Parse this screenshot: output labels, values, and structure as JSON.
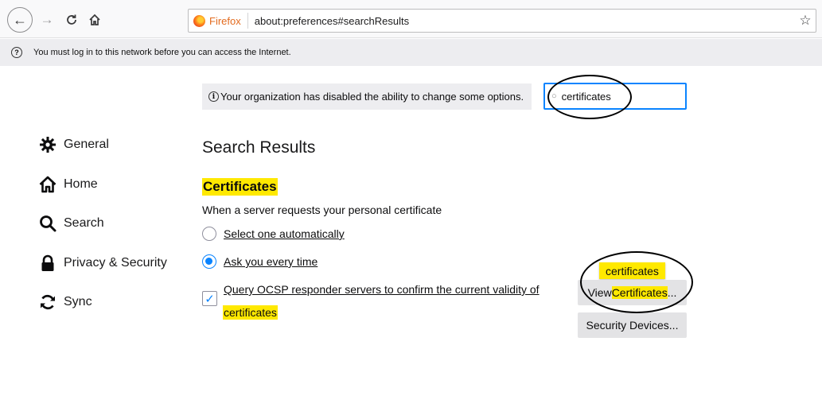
{
  "toolbar": {
    "back_icon": "arrow-left-icon",
    "forward_icon": "arrow-right-icon",
    "reload_icon": "reload-icon",
    "home_icon": "home-icon",
    "identity_label": "Firefox",
    "url": "about:preferences#searchResults",
    "bookmark_icon": "star-icon"
  },
  "notification": {
    "text": "You must log in to this network before you can access the Internet."
  },
  "sidebar": {
    "items": [
      {
        "label": "General",
        "icon": "gear-icon"
      },
      {
        "label": "Home",
        "icon": "home-icon"
      },
      {
        "label": "Search",
        "icon": "search-icon"
      },
      {
        "label": "Privacy & Security",
        "icon": "lock-icon"
      },
      {
        "label": "Sync",
        "icon": "sync-icon"
      }
    ]
  },
  "policy_notice": "Your organization has disabled the ability to change some options.",
  "search_field": {
    "value": "certificates"
  },
  "main": {
    "title": "Search Results",
    "section_title": "Certificates",
    "description": "When a server requests your personal certificate",
    "radio_options": [
      {
        "label": "Select one automatically",
        "selected": false
      },
      {
        "label": "Ask you every time",
        "selected": true
      }
    ],
    "ocsp_label_line1": "Query OCSP responder servers to confirm the current validity of",
    "ocsp_label_line2": "certificates",
    "ocsp_checked": true,
    "tooltip": "certificates",
    "view_button_prefix": "View ",
    "view_button_highlight": "Certificates",
    "view_button_suffix": "...",
    "security_devices_button": "Security Devices..."
  },
  "colors": {
    "accent": "#0a84ff",
    "highlight": "#ffe900",
    "firefox_orange": "#e36b1f"
  }
}
